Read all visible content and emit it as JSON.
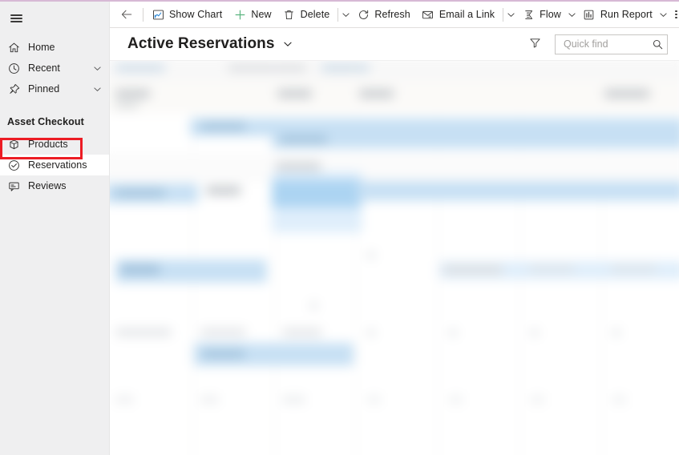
{
  "app": {
    "accent_top_border": "#d7b9d5",
    "sidebar_bg": "#efeff0",
    "annotation_color": "#ec1c24"
  },
  "sidebar": {
    "menu_button": "Menu",
    "items": [
      {
        "label": "Home",
        "icon": "home-icon",
        "expandable": false
      },
      {
        "label": "Recent",
        "icon": "clock-icon",
        "expandable": true
      },
      {
        "label": "Pinned",
        "icon": "pin-icon",
        "expandable": true
      }
    ],
    "group": {
      "title": "Asset Checkout",
      "items": [
        {
          "label": "Products",
          "icon": "cube-icon",
          "selected": false
        },
        {
          "label": "Reservations",
          "icon": "check-circle-icon",
          "selected": true
        },
        {
          "label": "Reviews",
          "icon": "comment-icon",
          "selected": false
        }
      ]
    }
  },
  "command_bar": {
    "back": "Back",
    "items": [
      {
        "label": "Show Chart",
        "icon": "chart-icon",
        "has_chevron": false
      },
      {
        "label": "New",
        "icon": "plus-icon",
        "has_chevron": false
      },
      {
        "label": "Delete",
        "icon": "trash-icon",
        "has_chevron": true
      },
      {
        "label": "Refresh",
        "icon": "refresh-icon",
        "has_chevron": false
      },
      {
        "label": "Email a Link",
        "icon": "email-link-icon",
        "has_chevron": true
      },
      {
        "label": "Flow",
        "icon": "flow-icon",
        "has_chevron": true
      },
      {
        "label": "Run Report",
        "icon": "report-icon",
        "has_chevron": true
      }
    ],
    "overflow": "More commands"
  },
  "view": {
    "title": "Active Reservations",
    "title_chevron": "chevron-down-icon",
    "filter_button": "filter-icon",
    "search": {
      "placeholder": "Quick find",
      "value": "",
      "icon": "search-icon"
    }
  },
  "grid": {
    "state": "redacted",
    "note": "Record grid content is blurred / obscured in the screenshot"
  }
}
